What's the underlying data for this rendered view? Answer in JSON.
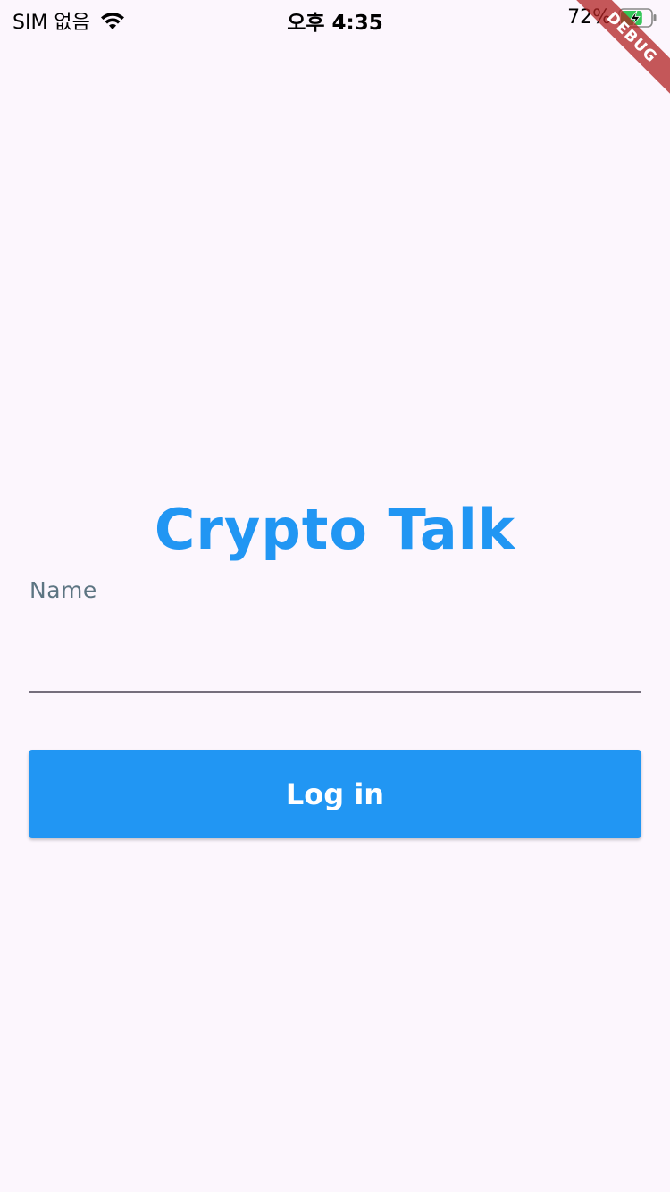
{
  "status_bar": {
    "carrier": "SIM 없음",
    "time": "오후 4:35",
    "battery_percent": "72%",
    "battery_level": 0.72,
    "charging": true,
    "icons": [
      "wifi-icon",
      "battery-icon",
      "charging-bolt-icon"
    ]
  },
  "debug_banner": {
    "label": "DEBUG"
  },
  "login": {
    "title": "Crypto Talk",
    "name_label": "Name",
    "name_value": "",
    "button_label": "Log in"
  },
  "colors": {
    "background": "#fcf6fd",
    "accent": "#2196f3",
    "label": "#5d7582",
    "underline": "#756e7c",
    "battery_fill": "#34c759",
    "debug_banner": "#b22222"
  }
}
